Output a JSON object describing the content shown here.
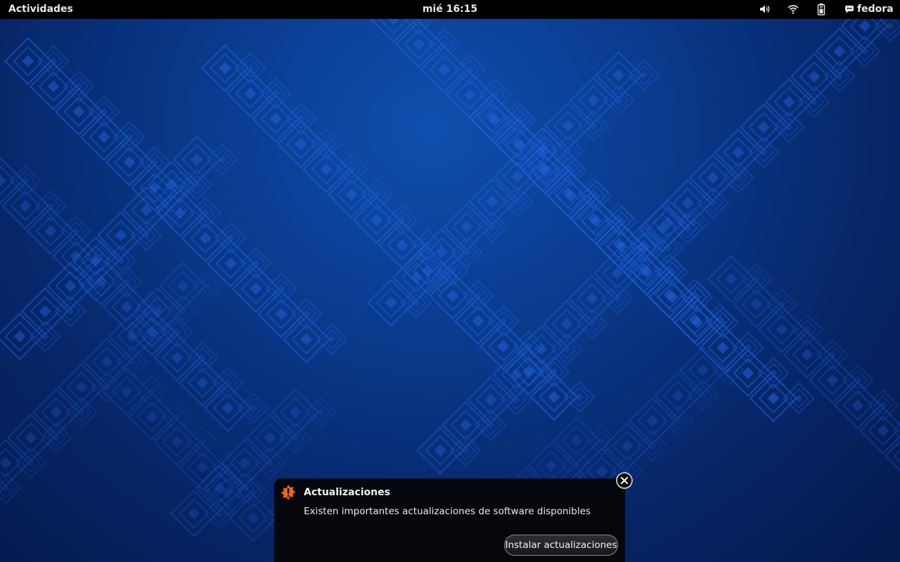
{
  "top_bar": {
    "activities_label": "Actividades",
    "clock": "mié 16:15",
    "username": "fedora",
    "tray_icons": [
      "volume-icon",
      "wifi-icon",
      "battery-icon",
      "user-status-icon"
    ]
  },
  "wallpaper": {
    "base_color": "#0a3a8c",
    "pattern_color": "#1e5fd6"
  },
  "notification": {
    "icon": "software-update-urgent-icon",
    "icon_color": "#f0671b",
    "title": "Actualizaciones",
    "body": "Existen importantes actualizaciones de software disponibles",
    "action_label": "Instalar actualizaciones",
    "close_icon": "close-icon"
  }
}
